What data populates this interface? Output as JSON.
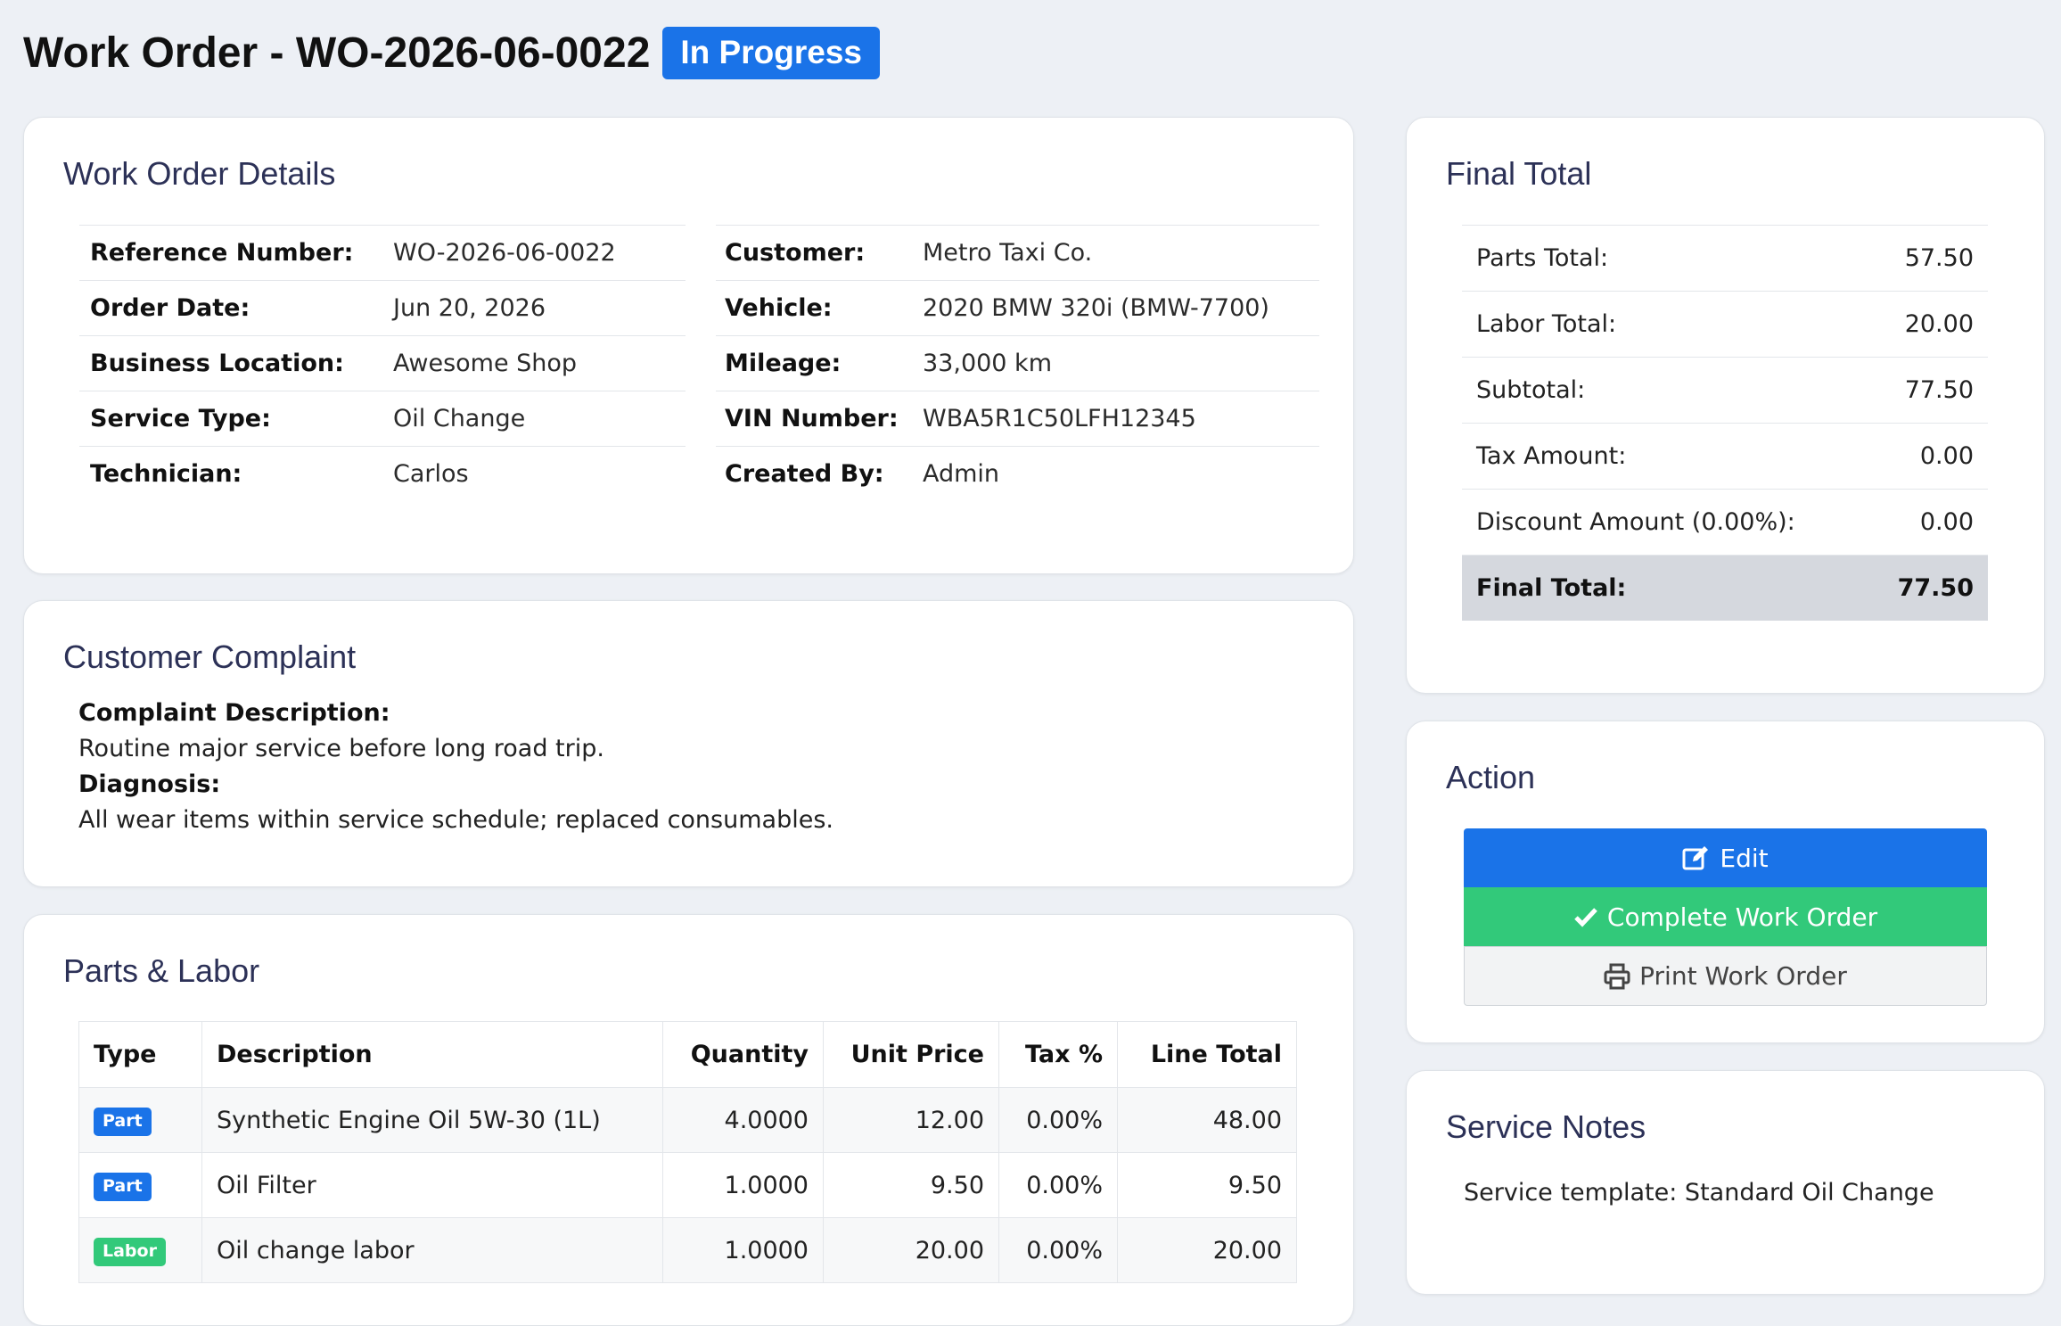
{
  "header": {
    "title": "Work Order - WO-2026-06-0022",
    "status": "In Progress"
  },
  "details": {
    "title": "Work Order Details",
    "left": [
      {
        "label": "Reference Number:",
        "value": "WO-2026-06-0022"
      },
      {
        "label": "Order Date:",
        "value": "Jun 20, 2026"
      },
      {
        "label": "Business Location:",
        "value": "Awesome Shop"
      },
      {
        "label": "Service Type:",
        "value": "Oil Change"
      },
      {
        "label": "Technician:",
        "value": "Carlos"
      }
    ],
    "right": [
      {
        "label": "Customer:",
        "value": "Metro Taxi Co."
      },
      {
        "label": "Vehicle:",
        "value": "2020 BMW 320i (BMW-7700)"
      },
      {
        "label": "Mileage:",
        "value": "33,000 km"
      },
      {
        "label": "VIN Number:",
        "value": "WBA5R1C50LFH12345"
      },
      {
        "label": "Created By:",
        "value": "Admin"
      }
    ]
  },
  "complaint": {
    "title": "Customer Complaint",
    "description_label": "Complaint Description:",
    "description": "Routine major service before long road trip.",
    "diagnosis_label": "Diagnosis:",
    "diagnosis": "All wear items within service schedule; replaced consumables."
  },
  "parts": {
    "title": "Parts & Labor",
    "headers": [
      "Type",
      "Description",
      "Quantity",
      "Unit Price",
      "Tax %",
      "Line Total"
    ],
    "rows": [
      {
        "type": "Part",
        "description": "Synthetic Engine Oil 5W-30 (1L)",
        "quantity": "4.0000",
        "unit_price": "12.00",
        "tax": "0.00%",
        "line_total": "48.00"
      },
      {
        "type": "Part",
        "description": "Oil Filter",
        "quantity": "1.0000",
        "unit_price": "9.50",
        "tax": "0.00%",
        "line_total": "9.50"
      },
      {
        "type": "Labor",
        "description": "Oil change labor",
        "quantity": "1.0000",
        "unit_price": "20.00",
        "tax": "0.00%",
        "line_total": "20.00"
      }
    ]
  },
  "totals": {
    "title": "Final Total",
    "rows": [
      {
        "label": "Parts Total:",
        "value": "57.50"
      },
      {
        "label": "Labor Total:",
        "value": "20.00"
      },
      {
        "label": "Subtotal:",
        "value": "77.50"
      },
      {
        "label": "Tax Amount:",
        "value": "0.00"
      },
      {
        "label": "Discount Amount (0.00%):",
        "value": "0.00"
      }
    ],
    "final_label": "Final Total:",
    "final_value": "77.50"
  },
  "actions": {
    "title": "Action",
    "edit": "Edit",
    "complete": "Complete Work Order",
    "print": "Print Work Order"
  },
  "notes": {
    "title": "Service Notes",
    "text": "Service template: Standard Oil Change"
  },
  "colors": {
    "primary": "#1a73e8",
    "success": "#32c97a",
    "part_badge": "#1a73e8",
    "labor_badge": "#32c97a"
  }
}
